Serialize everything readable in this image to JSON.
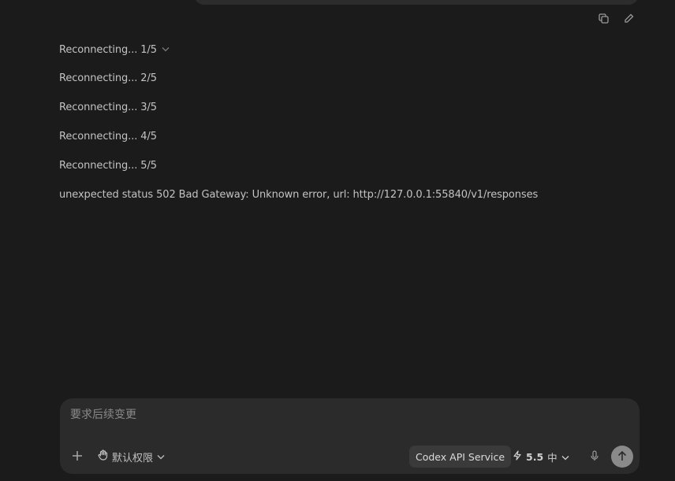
{
  "log": {
    "lines": [
      "Reconnecting... 1/5",
      "Reconnecting... 2/5",
      "Reconnecting... 3/5",
      "Reconnecting... 4/5",
      "Reconnecting... 5/5",
      "unexpected status 502 Bad Gateway: Unknown error, url: http://127.0.0.1:55840/v1/responses"
    ]
  },
  "composer": {
    "placeholder": "要求后续变更",
    "permissions_label": "默认权限",
    "service_label": "Codex API Service",
    "model_version": "5.5",
    "effort_label": "中"
  },
  "icons": {
    "copy": "copy-icon",
    "edit": "pencil-icon",
    "expand": "chevron-down-icon",
    "add": "plus-icon",
    "permissions": "hand-icon",
    "model": "lightning-icon",
    "mic": "mic-icon",
    "send": "arrow-up-icon"
  }
}
